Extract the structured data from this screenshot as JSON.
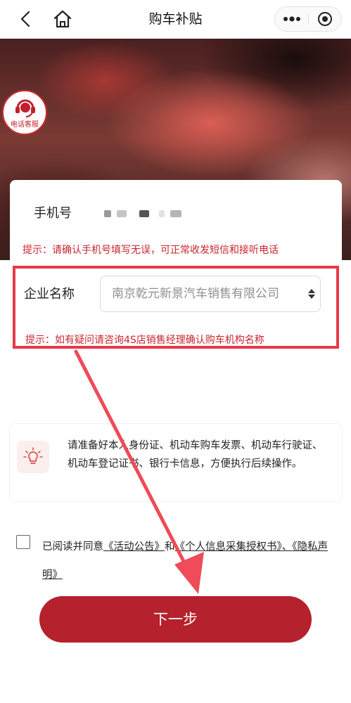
{
  "nav": {
    "title": "购车补贴",
    "back_icon": "chevron-left-icon",
    "home_icon": "home-icon",
    "more_icon": "more-dots-icon",
    "close_icon": "target-circle-icon"
  },
  "banner": {
    "service_label": "电话客服"
  },
  "form": {
    "phone_label": "手机号",
    "phone_hint": "提示：请确认手机号填写无误，可正常收发短信和接听电话",
    "company_label": "企业名称",
    "company_value": "南京乾元新景汽车销售有限公司",
    "company_hint": "提示：如有疑问请咨询4S店销售经理确认购车机构名称"
  },
  "tips": {
    "icon": "lightbulb-icon",
    "text": "请准备好本人身份证、机动车购车发票、机动车行驶证、机动车登记证书、银行卡信息，方便执行后续操作。"
  },
  "agreement": {
    "prefix": "已阅读并同意",
    "link_notice": "《活动公告》",
    "and": "和",
    "link_auth": "《个人信息采集授权书》",
    "sep": "、",
    "link_privacy": "《隐私声明》"
  },
  "next_button": "下一步",
  "colors": {
    "primary": "#b5212c",
    "hint": "#c8252e",
    "annotation": "#e8394a"
  }
}
